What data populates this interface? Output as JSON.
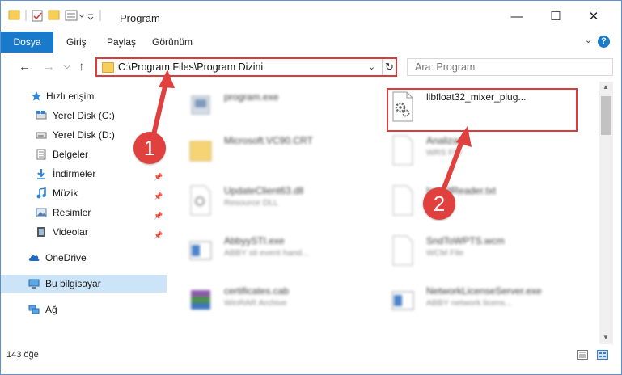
{
  "window": {
    "title": "Program",
    "minimize_glyph": "—",
    "maximize_glyph": "☐",
    "close_glyph": "✕"
  },
  "ribbon": {
    "file_tab": "Dosya",
    "tabs": [
      "Giriş",
      "Paylaş",
      "Görünüm"
    ],
    "help_glyph": "?"
  },
  "address": {
    "path": "C:\\Program Files\\Program Dizini",
    "search_placeholder": "Ara: Program"
  },
  "nav": {
    "items": [
      {
        "label": "Hızlı erişim",
        "icon": "star-icon"
      },
      {
        "label": "Yerel Disk (C:)",
        "icon": "drive-icon"
      },
      {
        "label": "Yerel Disk (D:)",
        "icon": "drive-icon"
      },
      {
        "label": "Belgeler",
        "icon": "documents-icon"
      },
      {
        "label": "İndirmeler",
        "icon": "download-icon"
      },
      {
        "label": "Müzik",
        "icon": "music-icon"
      },
      {
        "label": "Resimler",
        "icon": "pictures-icon"
      },
      {
        "label": "Videolar",
        "icon": "video-icon"
      },
      {
        "label": "OneDrive",
        "icon": "cloud-icon"
      },
      {
        "label": "Bu bilgisayar",
        "icon": "computer-icon"
      },
      {
        "label": "Ağ",
        "icon": "network-icon"
      }
    ]
  },
  "files": [
    {
      "name": "program.exe",
      "sub": ""
    },
    {
      "name": "libfloat32_mixer_plug...",
      "sub": ""
    },
    {
      "name": "Microsoft.VC90.CRT",
      "sub": ""
    },
    {
      "name": "Analizard",
      "sub": "WRS File"
    },
    {
      "name": "UpdateClient63.dll",
      "sub": "Resource DLL"
    },
    {
      "name": "InstallReader.txt",
      "sub": ""
    },
    {
      "name": "AbbyySTI.exe",
      "sub": "ABBY sti event hand..."
    },
    {
      "name": "SndToWPTS.wcm",
      "sub": "WCM File"
    },
    {
      "name": "certificates.cab",
      "sub": "WinRAR Archive"
    },
    {
      "name": "NetworkLicenseServer.exe",
      "sub": "ABBY network licens..."
    }
  ],
  "status": {
    "count": "143 öğe"
  },
  "annotations": {
    "badge1": "1",
    "badge2": "2"
  }
}
